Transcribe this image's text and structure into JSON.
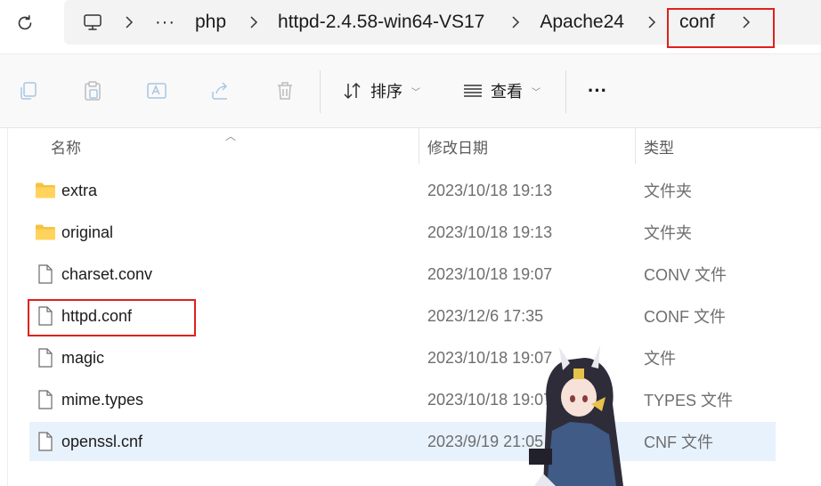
{
  "address_bar": {
    "crumbs": [
      {
        "label": "···",
        "kind": "overflow"
      },
      {
        "label": "php"
      },
      {
        "label": "httpd-2.4.58-win64-VS17"
      },
      {
        "label": "Apache24"
      },
      {
        "label": "conf"
      }
    ]
  },
  "toolbar": {
    "sort_label": "排序",
    "view_label": "查看",
    "more_label": "···"
  },
  "columns": {
    "name": "名称",
    "date": "修改日期",
    "type": "类型"
  },
  "files": [
    {
      "name": "extra",
      "date": "2023/10/18 19:13",
      "type": "文件夹",
      "icon": "folder-icon"
    },
    {
      "name": "original",
      "date": "2023/10/18 19:13",
      "type": "文件夹",
      "icon": "folder-icon"
    },
    {
      "name": "charset.conv",
      "date": "2023/10/18 19:07",
      "type": "CONV 文件",
      "icon": "file-icon"
    },
    {
      "name": "httpd.conf",
      "date": "2023/12/6 17:35",
      "type": "CONF 文件",
      "icon": "file-icon"
    },
    {
      "name": "magic",
      "date": "2023/10/18 19:07",
      "type": "文件",
      "icon": "file-icon"
    },
    {
      "name": "mime.types",
      "date": "2023/10/18 19:07",
      "type": "TYPES 文件",
      "icon": "file-icon"
    },
    {
      "name": "openssl.cnf",
      "date": "2023/9/19 21:05",
      "type": "CNF 文件",
      "icon": "file-icon",
      "selected": true
    }
  ],
  "colors": {
    "highlight_box": "#e0201b",
    "selected_row": "#e8f2fc",
    "folder": "#f5c242"
  }
}
